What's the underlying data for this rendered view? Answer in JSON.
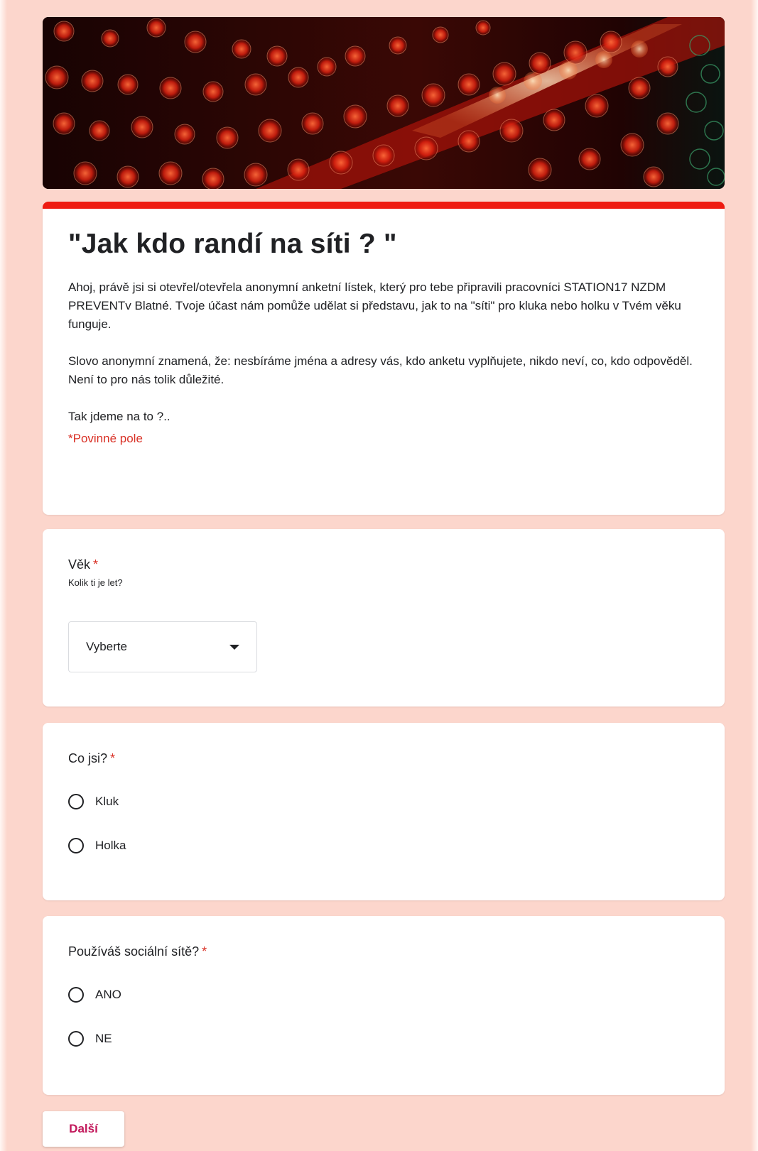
{
  "header": {
    "banner_icon": "bokeh-lights-image"
  },
  "form": {
    "title": "\"Jak kdo randí na síti ? \"",
    "description_1": "Ahoj, právě jsi si otevřel/otevřela anonymní anketní lístek, který pro tebe připravili pracovníci STATION17 NZDM PREVENTv Blatné. Tvoje účast nám pomůže udělat si představu, jak to na \"síti\" pro kluka nebo holku v Tvém věku funguje.",
    "description_2": "Slovo anonymní znamená, že: nesbíráme jména a adresy vás, kdo anketu vyplňujete, nikdo neví, co, kdo odpověděl. Není to pro nás tolik důležité.",
    "description_3": "Tak jdeme na to ?..",
    "required_note": "*Povinné pole"
  },
  "questions": {
    "age": {
      "title": "Věk",
      "required_mark": "*",
      "help": "Kolik ti je let?",
      "select_placeholder": "Vyberte"
    },
    "gender": {
      "title": "Co jsi?",
      "required_mark": "*",
      "options": [
        "Kluk",
        "Holka"
      ]
    },
    "social": {
      "title": "Používáš sociální sítě?",
      "required_mark": "*",
      "options": [
        "ANO",
        "NE"
      ]
    }
  },
  "footer": {
    "next_label": "Další"
  },
  "colors": {
    "background": "#fcd6cc",
    "accent": "#ee1b11",
    "required": "#d93025",
    "next_text": "#c2185b"
  }
}
